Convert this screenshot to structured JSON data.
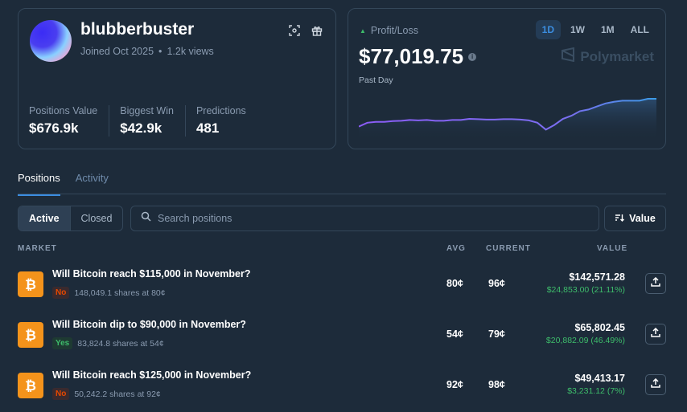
{
  "profile": {
    "username": "blubberbuster",
    "joined": "Joined Oct 2025",
    "views": "1.2k views",
    "stats": [
      {
        "label": "Positions Value",
        "value": "$676.9k"
      },
      {
        "label": "Biggest Win",
        "value": "$42.9k"
      },
      {
        "label": "Predictions",
        "value": "481"
      }
    ]
  },
  "pnl": {
    "label": "Profit/Loss",
    "value": "$77,019.75",
    "period": "Past Day",
    "ranges": [
      "1D",
      "1W",
      "1M",
      "ALL"
    ],
    "active_range": "1D",
    "brand": "Polymarket",
    "trend": [
      0.72,
      0.62,
      0.6,
      0.6,
      0.58,
      0.57,
      0.55,
      0.56,
      0.55,
      0.57,
      0.57,
      0.55,
      0.55,
      0.52,
      0.53,
      0.54,
      0.54,
      0.53,
      0.53,
      0.54,
      0.56,
      0.62,
      0.8,
      0.68,
      0.52,
      0.44,
      0.32,
      0.28,
      0.2,
      0.12,
      0.08,
      0.05,
      0.05,
      0.05,
      0.0,
      0.0
    ]
  },
  "tabs": [
    {
      "label": "Positions",
      "active": true
    },
    {
      "label": "Activity",
      "active": false
    }
  ],
  "filters": {
    "active": "Active",
    "closed": "Closed",
    "search_placeholder": "Search positions",
    "sort": "Value"
  },
  "columns": {
    "market": "MARKET",
    "avg": "AVG",
    "current": "CURRENT",
    "value": "VALUE"
  },
  "positions": [
    {
      "question": "Will Bitcoin reach $115,000 in November?",
      "outcome": "No",
      "shares": "148,049.1 shares at 80¢",
      "avg": "80¢",
      "current": "96¢",
      "value": "$142,571.28",
      "gain": "$24,853.00 (21.11%)"
    },
    {
      "question": "Will Bitcoin dip to $90,000 in November?",
      "outcome": "Yes",
      "shares": "83,824.8 shares at 54¢",
      "avg": "54¢",
      "current": "79¢",
      "value": "$65,802.45",
      "gain": "$20,882.09 (46.49%)"
    },
    {
      "question": "Will Bitcoin reach $125,000 in November?",
      "outcome": "No",
      "shares": "50,242.2 shares at 92¢",
      "avg": "92¢",
      "current": "98¢",
      "value": "$49,413.17",
      "gain": "$3,231.12 (7%)"
    }
  ],
  "colors": {
    "accent": "#3b8de0",
    "positive": "#3ebd6b",
    "negative": "#e64800",
    "bitcoin": "#f4931b",
    "line_start": "#8b5cf6",
    "line_end": "#3b9be6"
  },
  "icons": [
    "qr-scan-icon",
    "gift-icon",
    "info-icon",
    "polymarket-logo-icon",
    "search-icon",
    "sort-icon",
    "bitcoin-icon",
    "share-icon"
  ]
}
